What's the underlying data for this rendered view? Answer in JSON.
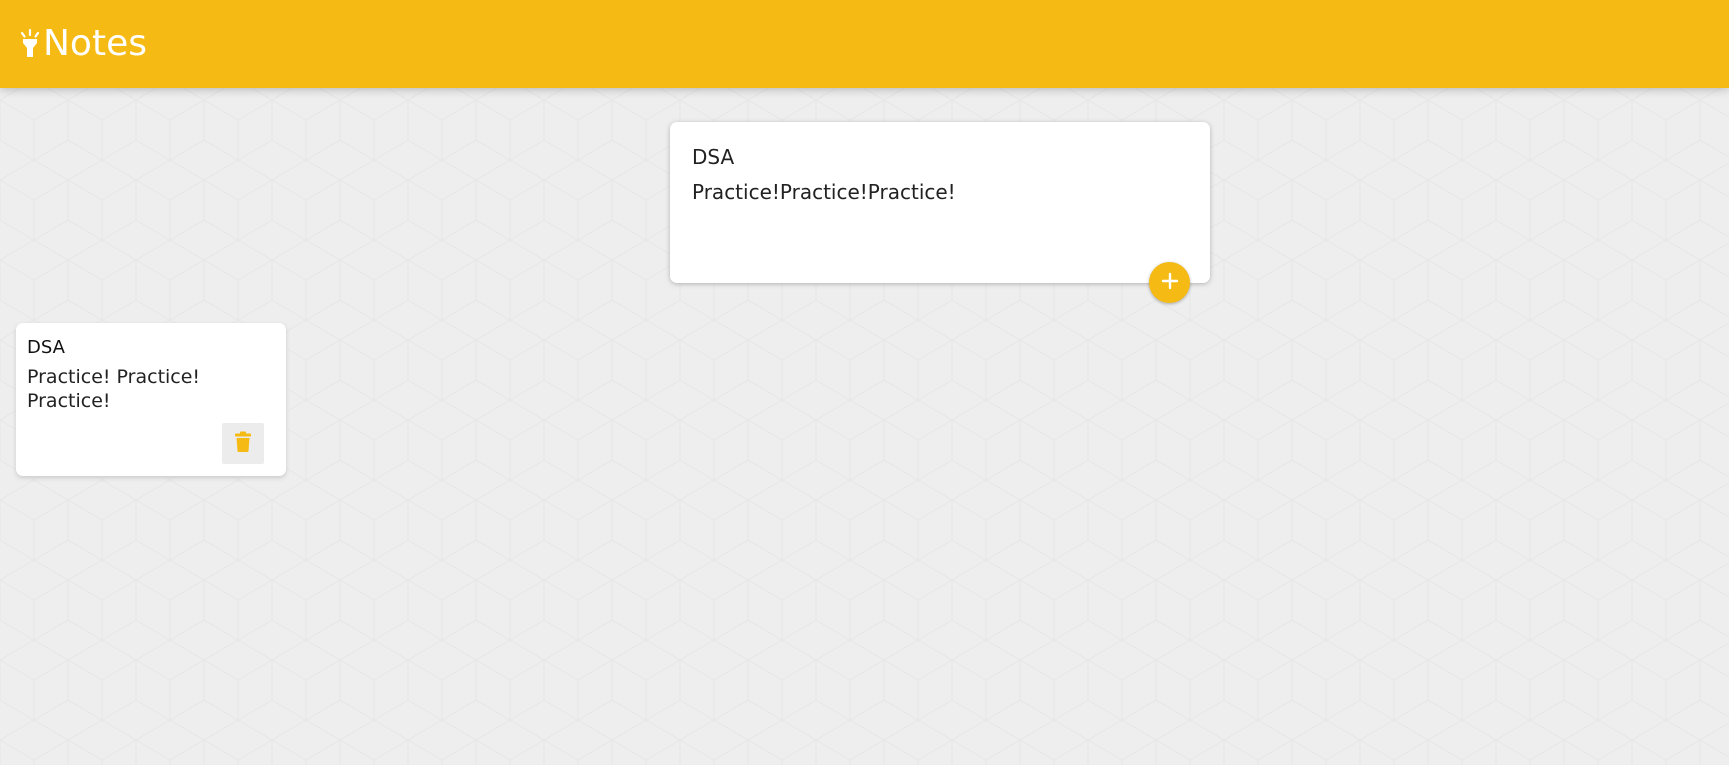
{
  "app": {
    "title": "Notes",
    "accent_color": "#f5ba13",
    "logo_icon": "highlight-icon"
  },
  "create_form": {
    "title_value": "DSA",
    "content_value": "Practice!Practice!Practice!",
    "add_button_icon": "add-icon"
  },
  "notes": [
    {
      "title": "DSA",
      "content": "Practice! Practice! Practice!",
      "delete_icon": "trash-icon"
    }
  ]
}
